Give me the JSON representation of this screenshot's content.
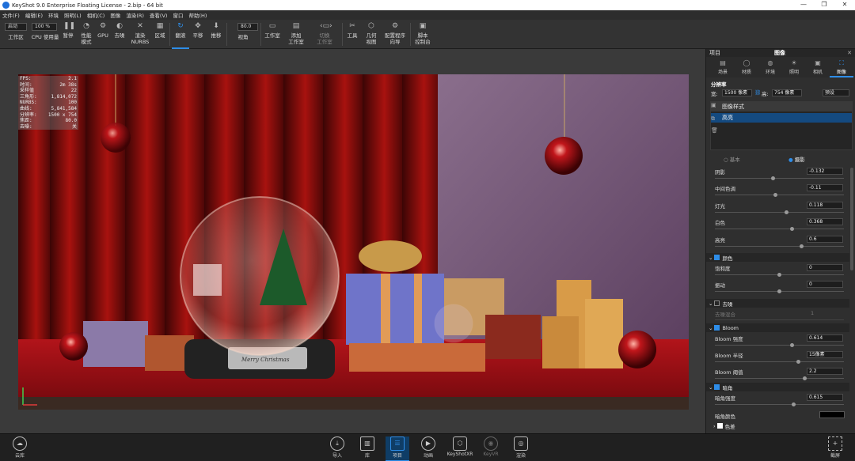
{
  "window": {
    "title": "KeyShot 9.0 Enterprise Floating License  - 2.bip  - 64 bit",
    "min_icon": "minimize-icon",
    "max_icon": "maximize-icon",
    "close_icon": "close-icon",
    "min": "—",
    "max": "❐",
    "close": "✕"
  },
  "menu": [
    "文件(F)",
    "编辑(E)",
    "环境",
    "照明(L)",
    "相机(C)",
    "图像",
    "渲染(R)",
    "查看(V)",
    "窗口",
    "帮助(H)"
  ],
  "toolbar": {
    "workspace_select": "启动",
    "zoom_select": "100 %",
    "workspace_label": "工作区",
    "cpu_label": "CPU 使用量",
    "pause_label": "暂停",
    "perf_label": "性能\n模式",
    "gpu_label": "GPU",
    "denoise_label": "去噪",
    "nurbs_label": "渲染\nNURBS",
    "region_label": "区域",
    "tumble_label": "翻滚",
    "pan_label": "平移",
    "dolly_label": "推移",
    "fov_value": "80.0",
    "fov_label": "视角",
    "studio_label": "工作室",
    "add_studio_label": "添加\n工作室",
    "switch_studio_label": "切换\n工作室",
    "tools_label": "工具",
    "geometry_label": "几何\n视图",
    "config_label": "配置程序\n向导",
    "script_label": "脚本\n控制台"
  },
  "stats": [
    {
      "k": "FPS:",
      "v": "2.1"
    },
    {
      "k": "时间:",
      "v": "2m 38s"
    },
    {
      "k": "采样值",
      "v": "22"
    },
    {
      "k": "三角形:",
      "v": "1,814,072"
    },
    {
      "k": "NURBS:",
      "v": "100"
    },
    {
      "k": "曲线:",
      "v": "5,841,584"
    },
    {
      "k": "分辨率:",
      "v": "1500 x 754"
    },
    {
      "k": "焦距:",
      "v": "80.0"
    },
    {
      "k": "去噪:",
      "v": "关"
    }
  ],
  "render_text": {
    "plaque": "Merry Christmas"
  },
  "panel": {
    "header_left": "项目",
    "header_title": "图像",
    "tabs": [
      {
        "label": "场景",
        "icon": "scene-icon",
        "glyph": "▤"
      },
      {
        "label": "材质",
        "icon": "material-icon",
        "glyph": "◯"
      },
      {
        "label": "环境",
        "icon": "environment-icon",
        "glyph": "◍"
      },
      {
        "label": "照明",
        "icon": "lighting-icon",
        "glyph": "☀"
      },
      {
        "label": "相机",
        "icon": "camera-icon",
        "glyph": "▣"
      },
      {
        "label": "图像",
        "icon": "image-icon",
        "glyph": "⛶"
      }
    ],
    "resolution_label": "分辨率",
    "width_label": "宽:",
    "width_value": "1500 像素",
    "height_label": "高:",
    "height_value": "754 像素",
    "preset_label": "预设",
    "style_list_label": "图像样式",
    "style_item": "高亮",
    "mode_basic": "基本",
    "mode_photo": "摄影",
    "sliders": [
      {
        "label": "阴影",
        "value": "-0.132",
        "pos": 0.45
      },
      {
        "label": "中间色调",
        "value": "-0.11",
        "pos": 0.47
      },
      {
        "label": "灯光",
        "value": "0.118",
        "pos": 0.56
      },
      {
        "label": "白色",
        "value": "0.368",
        "pos": 0.6
      },
      {
        "label": "高亮",
        "value": "0.6",
        "pos": 0.68
      }
    ],
    "color_section": "颜色",
    "color_sliders": [
      {
        "label": "饱和度",
        "value": "0",
        "pos": 0.5
      },
      {
        "label": "振动",
        "value": "0",
        "pos": 0.5
      }
    ],
    "haze_section": "去噪",
    "haze_label": "去噪混合",
    "haze_value": "1",
    "bloom_section": "Bloom",
    "bloom_sliders": [
      {
        "label": "Bloom 强度",
        "value": "0.614",
        "pos": 0.6
      },
      {
        "label": "Bloom 半径",
        "value": "15像素",
        "pos": 0.65
      },
      {
        "label": "Bloom 阈值",
        "value": "2.2",
        "pos": 0.7
      }
    ],
    "vignette_section": "暗角",
    "vignette_label": "暗角强度",
    "vignette_value": "0.615",
    "vignette_color_label": "暗角颜色",
    "chroma_section": "色差"
  },
  "bottom": {
    "library": "云库",
    "import": "导入",
    "lib": "库",
    "project": "项目",
    "animation": "动画",
    "keyshotxr": "KeyShotXR",
    "keyvr": "KeyVR",
    "render": "渲染",
    "screenshot": "截屏"
  }
}
